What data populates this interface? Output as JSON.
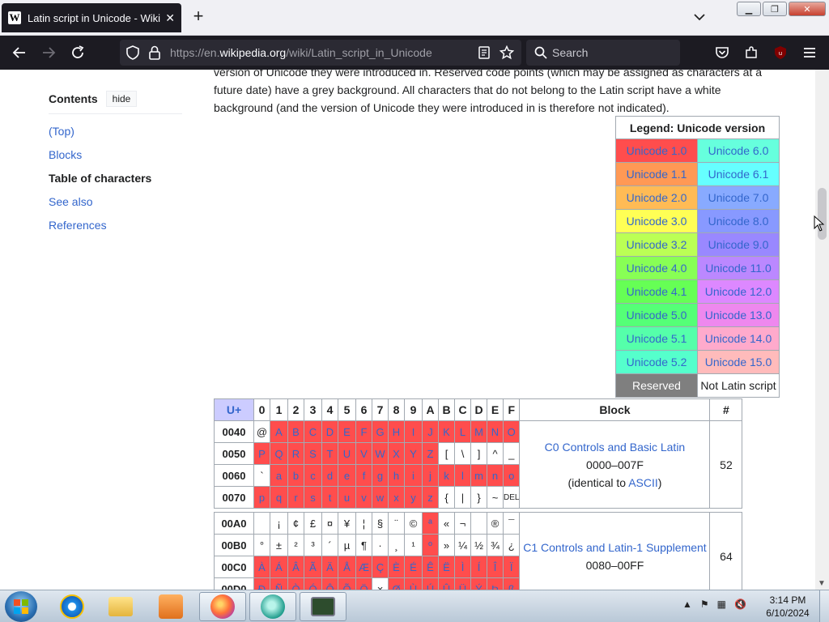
{
  "browser": {
    "tab_title": "Latin script in Unicode - Wikipe",
    "url_prefix": "https://en.",
    "url_domain": "wikipedia.org",
    "url_path": "/wiki/Latin_script_in_Unicode",
    "search_placeholder": "Search"
  },
  "toc": {
    "title": "Contents",
    "hide_label": "hide",
    "items": [
      {
        "label": "(Top)"
      },
      {
        "label": "Blocks"
      },
      {
        "label": "Table of characters"
      },
      {
        "label": "See also"
      },
      {
        "label": "References"
      }
    ]
  },
  "intro": {
    "line1": "version of Unicode they were introduced in. Reserved code points (which may be assigned as characters at a",
    "line2": "future date) have a grey background. All characters that do not belong to the Latin script have a white",
    "line3": "background (and the version of Unicode they were introduced in is therefore not indicated)."
  },
  "legend": {
    "title": "Legend: Unicode version",
    "rows": [
      {
        "left": "Unicode 1.0",
        "left_color": "#ff4d4d",
        "right": "Unicode 6.0",
        "right_color": "#66ffdd"
      },
      {
        "left": "Unicode 1.1",
        "left_color": "#ff9955",
        "right": "Unicode 6.1",
        "right_color": "#66ffff"
      },
      {
        "left": "Unicode 2.0",
        "left_color": "#ffbb55",
        "right": "Unicode 7.0",
        "right_color": "#88aaff"
      },
      {
        "left": "Unicode 3.0",
        "left_color": "#ffff55",
        "right": "Unicode 8.0",
        "right_color": "#8899ff"
      },
      {
        "left": "Unicode 3.2",
        "left_color": "#bbff55",
        "right": "Unicode 9.0",
        "right_color": "#9988ff"
      },
      {
        "left": "Unicode 4.0",
        "left_color": "#88ff55",
        "right": "Unicode 11.0",
        "right_color": "#bb88ff"
      },
      {
        "left": "Unicode 4.1",
        "left_color": "#66ff55",
        "right": "Unicode 12.0",
        "right_color": "#dd88ff"
      },
      {
        "left": "Unicode 5.0",
        "left_color": "#55ff77",
        "right": "Unicode 13.0",
        "right_color": "#ee88ee"
      },
      {
        "left": "Unicode 5.1",
        "left_color": "#55ffaa",
        "right": "Unicode 14.0",
        "right_color": "#ffaacc"
      },
      {
        "left": "Unicode 5.2",
        "left_color": "#55ffcc",
        "right": "Unicode 15.0",
        "right_color": "#ffbbbb"
      }
    ],
    "reserved_label": "Reserved",
    "not_latin_label": "Not Latin script"
  },
  "chartable": {
    "header": {
      "uplus": "U+",
      "cols": [
        "0",
        "1",
        "2",
        "3",
        "4",
        "5",
        "6",
        "7",
        "8",
        "9",
        "A",
        "B",
        "C",
        "D",
        "E",
        "F"
      ],
      "block": "Block",
      "count": "#"
    },
    "group1": {
      "rows": [
        {
          "code": "0040",
          "cells": [
            "@",
            "A",
            "B",
            "C",
            "D",
            "E",
            "F",
            "G",
            "H",
            "I",
            "J",
            "K",
            "L",
            "M",
            "N",
            "O"
          ]
        },
        {
          "code": "0050",
          "cells": [
            "P",
            "Q",
            "R",
            "S",
            "T",
            "U",
            "V",
            "W",
            "X",
            "Y",
            "Z",
            "[",
            "\\",
            "]",
            "^",
            "_"
          ]
        },
        {
          "code": "0060",
          "cells": [
            "`",
            "a",
            "b",
            "c",
            "d",
            "e",
            "f",
            "g",
            "h",
            "i",
            "j",
            "k",
            "l",
            "m",
            "n",
            "o"
          ]
        },
        {
          "code": "0070",
          "cells": [
            "p",
            "q",
            "r",
            "s",
            "t",
            "u",
            "v",
            "w",
            "x",
            "y",
            "z",
            "{",
            "|",
            "}",
            "~",
            "DEL"
          ]
        }
      ],
      "block_name": "C0 Controls and Basic Latin",
      "block_range": "0000–007F",
      "block_note_pre": "(identical to ",
      "block_note_link": "ASCII",
      "block_note_post": ")",
      "count": "52"
    },
    "group2": {
      "rows": [
        {
          "code": "00A0",
          "cells": [
            "",
            "¡",
            "¢",
            "£",
            "¤",
            "¥",
            "¦",
            "§",
            "¨",
            "©",
            "ª",
            "«",
            "¬",
            "",
            "®",
            "¯"
          ]
        },
        {
          "code": "00B0",
          "cells": [
            "°",
            "±",
            "²",
            "³",
            "´",
            "µ",
            "¶",
            "·",
            "¸",
            "¹",
            "º",
            "»",
            "¼",
            "½",
            "¾",
            "¿"
          ]
        },
        {
          "code": "00C0",
          "cells": [
            "À",
            "Á",
            "Â",
            "Ã",
            "Ä",
            "Å",
            "Æ",
            "Ç",
            "È",
            "É",
            "Ê",
            "Ë",
            "Ì",
            "Í",
            "Î",
            "Ï"
          ]
        },
        {
          "code": "00D0",
          "cells": [
            "Ð",
            "Ñ",
            "Ò",
            "Ó",
            "Ô",
            "Õ",
            "Ö",
            "×",
            "Ø",
            "Ù",
            "Ú",
            "Û",
            "Ü",
            "Ý",
            "Þ",
            "ß"
          ]
        }
      ],
      "block_name": "C1 Controls and Latin-1 Supplement",
      "block_range": "0080–00FF",
      "count": "64"
    }
  },
  "taskbar": {
    "time": "3:14 PM",
    "date": "6/10/2024"
  }
}
